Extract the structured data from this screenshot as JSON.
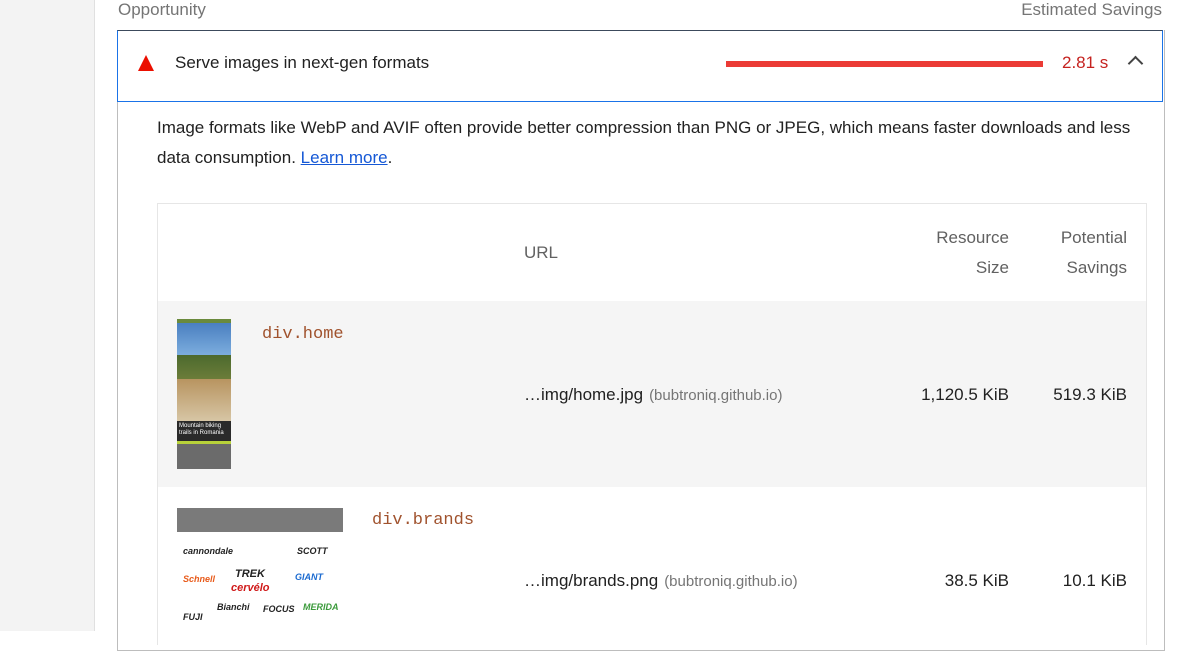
{
  "columns": {
    "opportunity": "Opportunity",
    "estimated_savings": "Estimated Savings"
  },
  "audit": {
    "title": "Serve images in next-gen formats",
    "savings": "2.81 s",
    "savings_fraction": 1.0,
    "status_color": "#eb0f00",
    "description_before": "Image formats like WebP and AVIF often provide better compression than PNG or JPEG, which means faster downloads and less data consumption. ",
    "learn_more": "Learn more",
    "description_after": "."
  },
  "table": {
    "headers": {
      "url": "URL",
      "resource_size_1": "Resource",
      "resource_size_2": "Size",
      "potential_savings_1": "Potential",
      "potential_savings_2": "Savings"
    },
    "rows": [
      {
        "node": "div.home",
        "url": "…img/home.jpg",
        "host": "(bubtroniq.github.io)",
        "size": "1,120.5 KiB",
        "savings": "519.3 KiB",
        "thumb_caption": "Mountain biking trails in Romania"
      },
      {
        "node": "div.brands",
        "url": "…img/brands.png",
        "host": "(bubtroniq.github.io)",
        "size": "38.5 KiB",
        "savings": "10.1 KiB",
        "brand_logos": [
          "cannondale",
          "TREK",
          "SCOTT",
          "Schnell",
          "cervélo",
          "GIANT",
          "FUJI",
          "Bianchi",
          "FOCUS",
          "MERIDA"
        ]
      }
    ]
  }
}
